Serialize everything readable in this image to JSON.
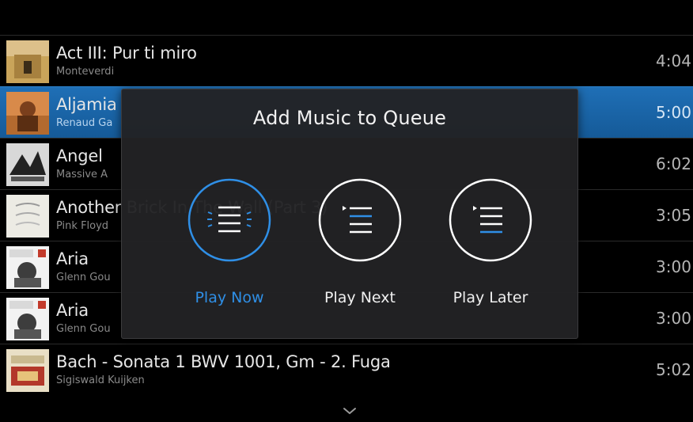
{
  "tracks": [
    {
      "title": "Act III: Pur ti miro",
      "artist": "Monteverdi",
      "duration": "4:04",
      "selected": false
    },
    {
      "title": "Aljamia",
      "artist": "Renaud Ga",
      "duration": "5:00",
      "selected": true
    },
    {
      "title": "Angel",
      "artist": "Massive A",
      "duration": "6:02",
      "selected": false
    },
    {
      "title": "Another Brick In The Wall (Part 3)",
      "artist": "Pink Floyd",
      "duration": "3:05",
      "selected": false
    },
    {
      "title": "Aria",
      "artist": "Glenn Gou",
      "duration": "3:00",
      "selected": false
    },
    {
      "title": "Aria",
      "artist": "Glenn Gou",
      "duration": "3:00",
      "selected": false
    },
    {
      "title": "Bach - Sonata 1 BWV 1001, Gm - 2. Fuga",
      "artist": "Sigiswald Kuijken",
      "duration": "5:02",
      "selected": false
    }
  ],
  "dialog": {
    "title": "Add Music to Queue",
    "options": [
      {
        "label": "Play Now",
        "icon": "play-now-icon",
        "active": true
      },
      {
        "label": "Play Next",
        "icon": "play-next-icon",
        "active": false
      },
      {
        "label": "Play Later",
        "icon": "play-later-icon",
        "active": false
      }
    ]
  },
  "colors": {
    "accent": "#2f8fe6",
    "selected_row": "#1f6fb6",
    "background": "#000000",
    "dialog": "#222224"
  },
  "icons": {
    "scroll": "chevron-down-icon"
  }
}
